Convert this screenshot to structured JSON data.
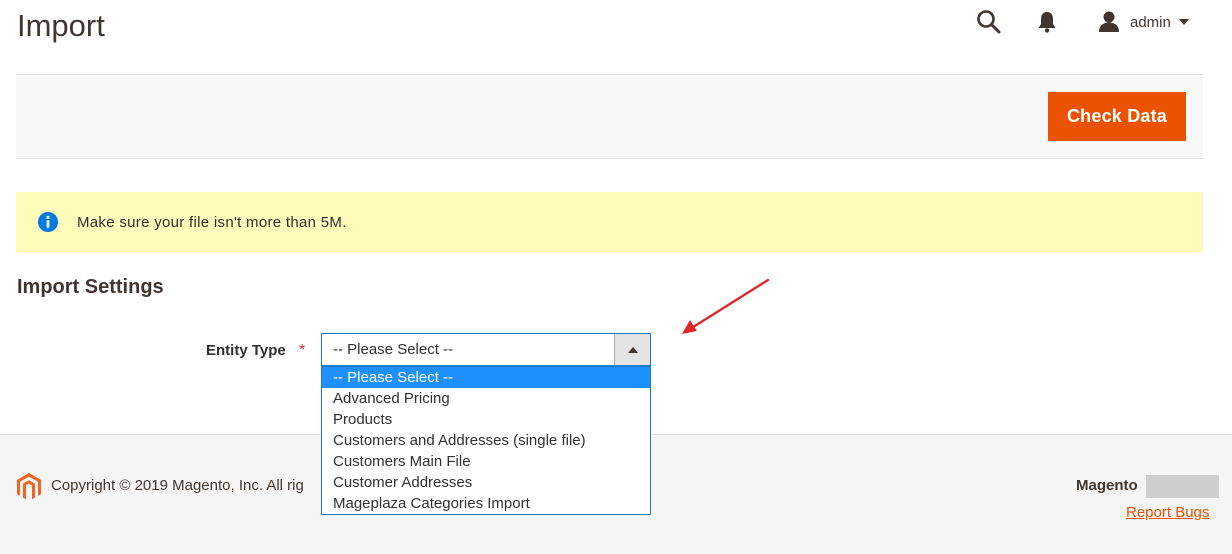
{
  "page": {
    "title": "Import"
  },
  "header": {
    "search_icon": "search-icon",
    "notifications_icon": "bell-icon",
    "user": {
      "name": "admin",
      "icon": "user-icon"
    }
  },
  "actions": {
    "check_data_label": "Check Data"
  },
  "notice": {
    "icon": "info-icon",
    "text": "Make sure your file isn't more than 5M."
  },
  "import_settings": {
    "title": "Import Settings",
    "entity_type": {
      "label": "Entity Type",
      "required_mark": "*",
      "selected": "-- Please Select --",
      "options": [
        "-- Please Select --",
        "Advanced Pricing",
        "Products",
        "Customers and Addresses (single file)",
        "Customers Main File",
        "Customer Addresses",
        "Mageplaza Categories Import"
      ]
    }
  },
  "footer": {
    "copyright": "Copyright © 2019 Magento, Inc. All rig",
    "brand": "Magento",
    "report_bugs": "Report Bugs"
  },
  "colors": {
    "accent": "#eb5202",
    "notice_bg": "#fffbbb",
    "select_border": "#1979c3",
    "option_selected_bg": "#1e90ff",
    "annotation_arrow": "#e22626"
  }
}
